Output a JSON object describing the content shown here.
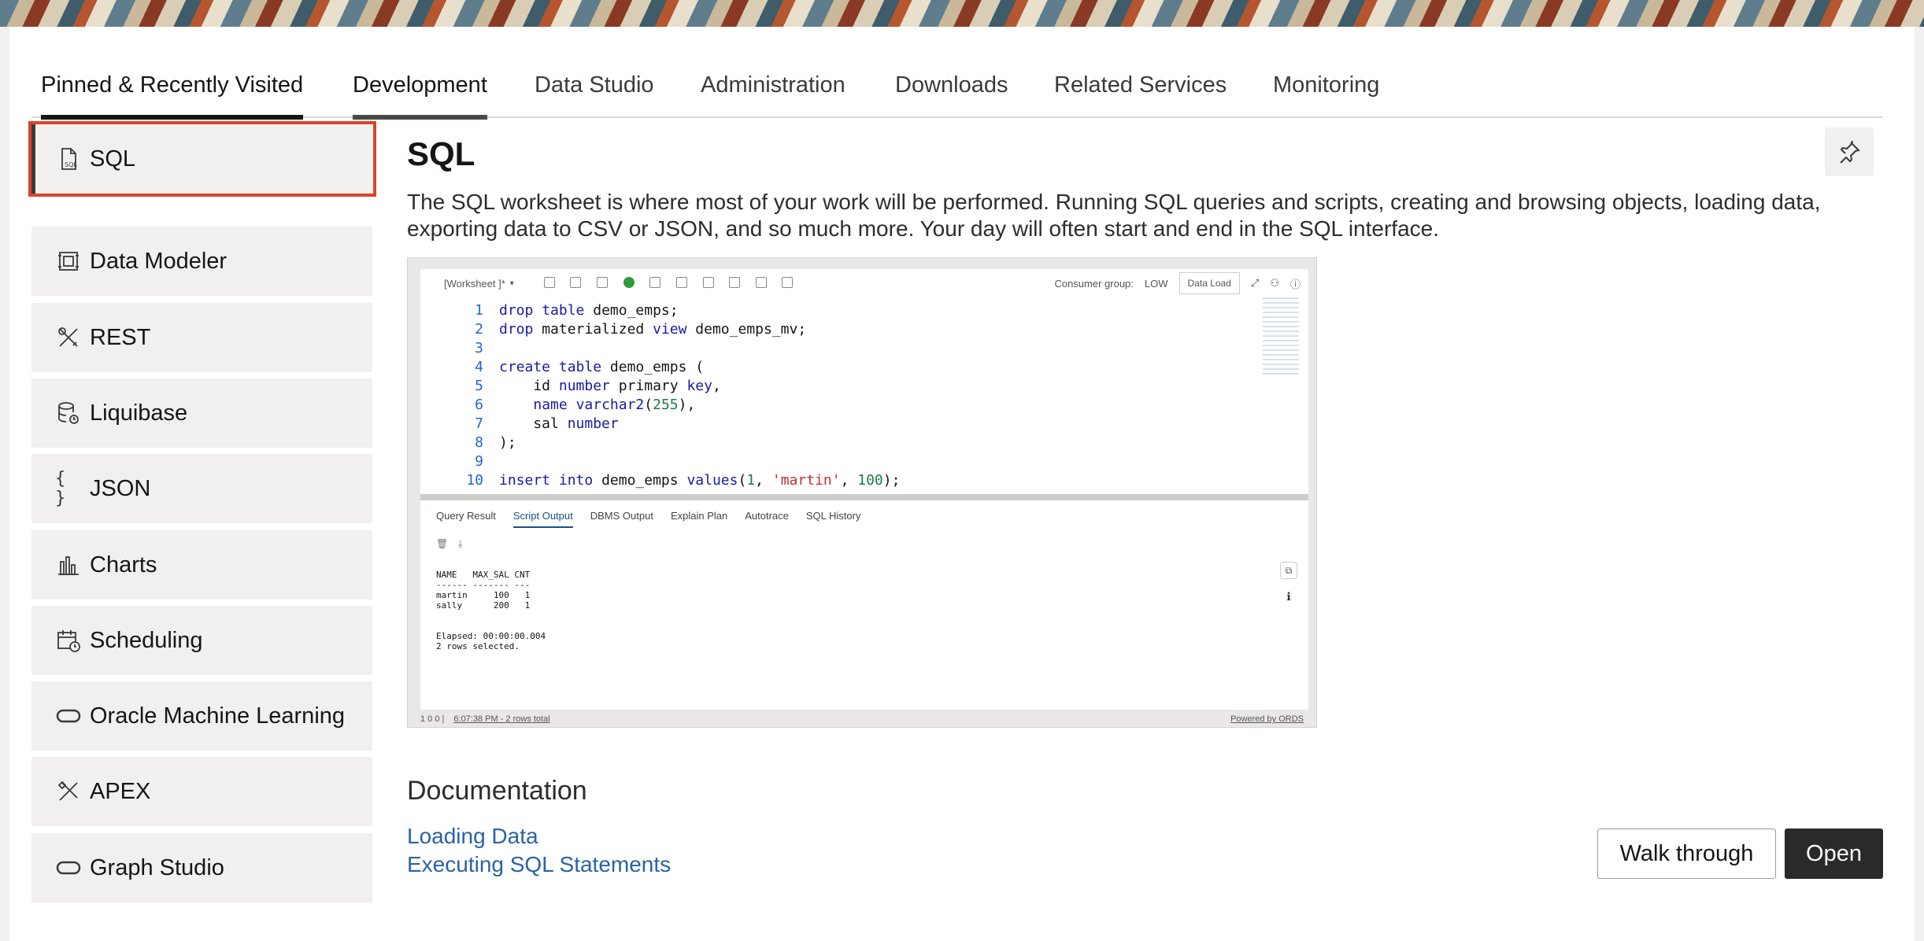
{
  "tabs": [
    {
      "label": "Pinned & Recently Visited"
    },
    {
      "label": "Development"
    },
    {
      "label": "Data Studio"
    },
    {
      "label": "Administration"
    },
    {
      "label": "Downloads"
    },
    {
      "label": "Related Services"
    },
    {
      "label": "Monitoring"
    }
  ],
  "sidebar": {
    "items": [
      {
        "label": "SQL",
        "icon": "sql-file-icon"
      },
      {
        "label": "Data Modeler",
        "icon": "data-modeler-icon"
      },
      {
        "label": "REST",
        "icon": "rest-tools-icon"
      },
      {
        "label": "Liquibase",
        "icon": "liquibase-database-icon"
      },
      {
        "label": "JSON",
        "icon": "json-braces-icon"
      },
      {
        "label": "Charts",
        "icon": "bar-chart-icon"
      },
      {
        "label": "Scheduling",
        "icon": "calendar-clock-icon"
      },
      {
        "label": "Oracle Machine Learning",
        "icon": "ml-pill-icon"
      },
      {
        "label": "APEX",
        "icon": "apex-tools-icon"
      },
      {
        "label": "Graph Studio",
        "icon": "graph-pill-icon"
      }
    ]
  },
  "main": {
    "title": "SQL",
    "description": "The SQL worksheet is where most of your work will be performed. Running SQL queries and scripts, creating and browsing objects, loading data, exporting data to CSV or JSON, and so much more. Your day will often start and end in the SQL interface."
  },
  "preview": {
    "worksheet_label": "[Worksheet ]*",
    "consumer_group_label": "Consumer group:",
    "consumer_group_value": "LOW",
    "data_load_label": "Data Load",
    "result_tabs": [
      "Query Result",
      "Script Output",
      "DBMS Output",
      "Explain Plan",
      "Autotrace",
      "SQL History"
    ],
    "output_text": "NAME   MAX_SAL CNT\n------ ------- ---\nmartin     100   1\nsally      200   1\n\n\nElapsed: 00:00:00.004\n2 rows selected.",
    "status_counts": "1   0   0  |",
    "status_time": "6:07:38 PM - 2 rows total",
    "powered_by": "Powered by ORDS"
  },
  "documentation": {
    "title": "Documentation",
    "links": [
      "Loading Data",
      "Executing SQL Statements"
    ]
  },
  "actions": {
    "walk_through": "Walk through",
    "open": "Open"
  },
  "colors": {
    "highlight": "#d9442c",
    "link": "#2a62a8",
    "primary_button": "#2b2a28"
  }
}
